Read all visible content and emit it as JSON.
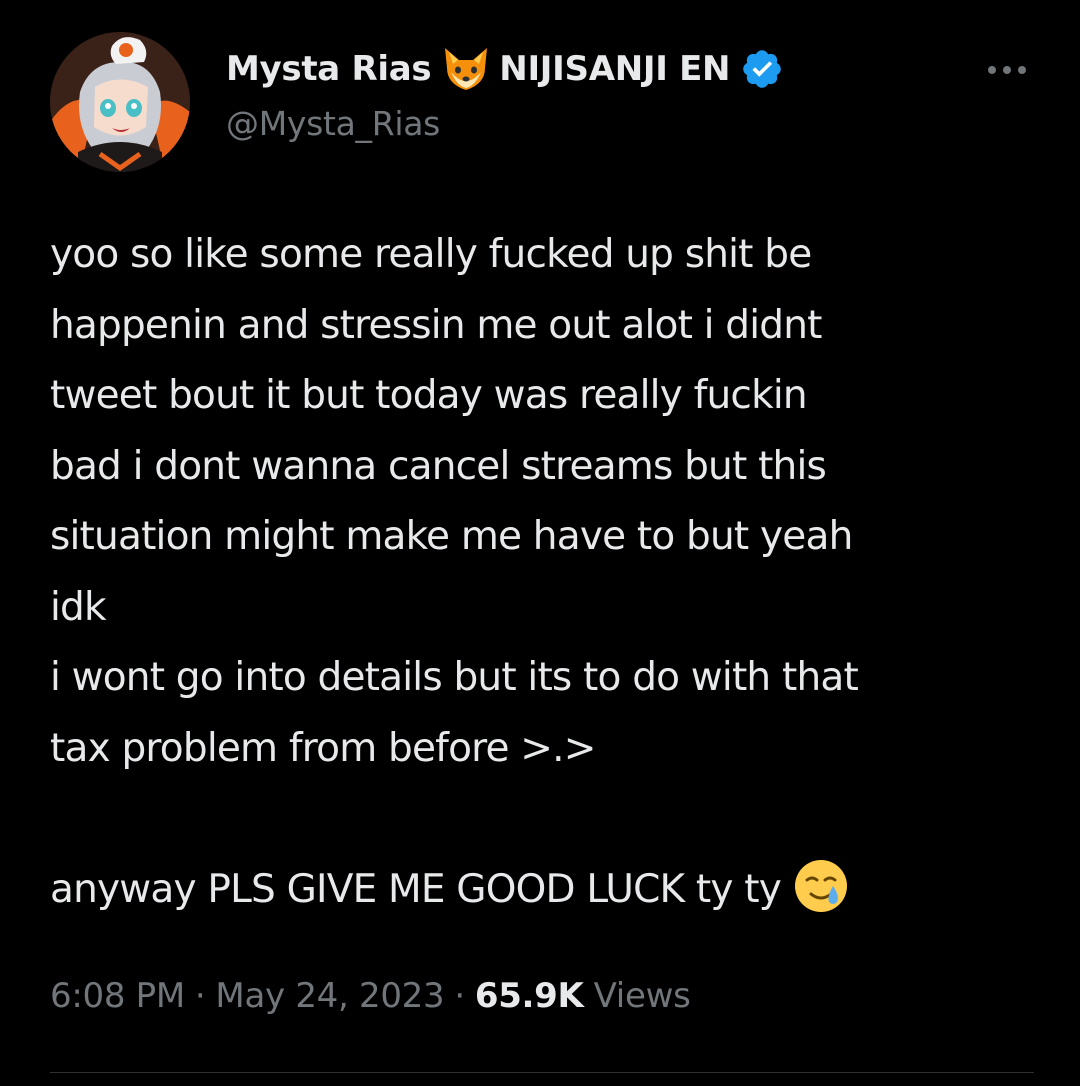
{
  "author": {
    "display_name": "Mysta Rias",
    "name_suffix": "NIJISANJI EN",
    "handle": "@Mysta_Rias",
    "badge_icon": "fox-icon",
    "verified_icon": "verified-badge-icon",
    "verified_color": "#1d9bf0"
  },
  "tweet": {
    "lines": [
      "yoo so like some really fucked up shit be",
      "happenin and stressin me out alot i didnt",
      "tweet bout it but today was really fuckin",
      "bad i dont wanna cancel streams but this",
      "situation might make me have to but yeah",
      "idk",
      "i wont go into details but its to do with that",
      "tax problem from before >.>",
      "",
      "anyway PLS GIVE ME GOOD LUCK ty ty"
    ],
    "trailing_emoji": "smiling-face-with-tear-icon"
  },
  "meta": {
    "time": "6:08 PM",
    "separator": "·",
    "date": "May 24, 2023",
    "views_count": "65.9K",
    "views_label": "Views"
  },
  "colors": {
    "background": "#000000",
    "text_primary": "#e7e9ea",
    "text_secondary": "#71767b",
    "divider": "#2f3336"
  }
}
